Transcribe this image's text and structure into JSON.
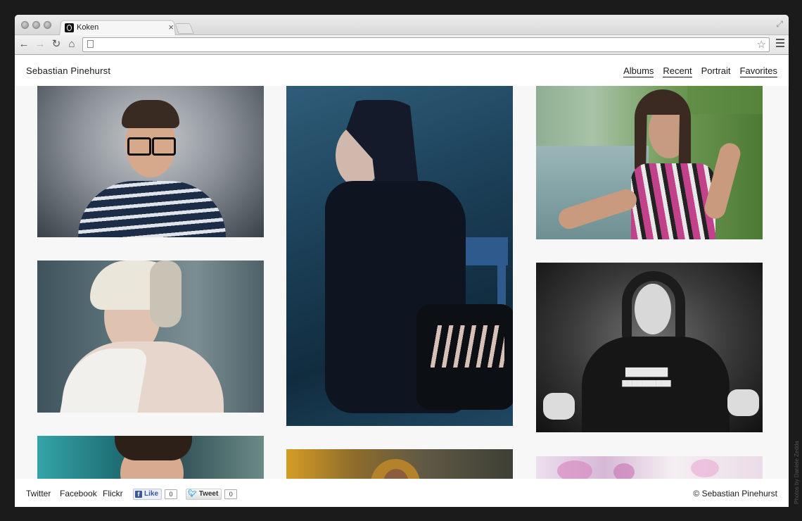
{
  "browser": {
    "tab_title": "Koken",
    "tab_close": "×",
    "url": "",
    "icons": {
      "back": "arrow-left-icon",
      "forward": "arrow-right-icon",
      "reload": "reload-icon",
      "home": "home-icon",
      "bookmark": "star-icon",
      "menu": "hamburger-menu-icon",
      "fullscreen": "fullscreen-icon"
    }
  },
  "site": {
    "title": "Sebastian Pinehurst",
    "nav": [
      {
        "label": "Albums",
        "underlined": true
      },
      {
        "label": "Recent",
        "underlined": true
      },
      {
        "label": "Portrait",
        "underlined": false
      },
      {
        "label": "Favorites",
        "underlined": true
      }
    ]
  },
  "gallery": {
    "photos": [
      {
        "subject": "man with glasses and striped sweater"
      },
      {
        "subject": "woman in dark dress on blue chair"
      },
      {
        "subject": "young woman by river"
      },
      {
        "subject": "blonde woman in knit beanie"
      },
      {
        "subject": "man in black hoodie, black and white"
      },
      {
        "subject": "man portrait, teal background"
      },
      {
        "subject": "person in yellow hood"
      },
      {
        "subject": "pink blossoms"
      }
    ]
  },
  "footer": {
    "links": [
      "Twitter",
      "Facebook",
      "Flickr"
    ],
    "like_label": "Like",
    "like_count": "0",
    "tweet_label": "Tweet",
    "tweet_count": "0",
    "copyright": "© Sebastian Pinehurst"
  },
  "credit": "Photos by Daniele Zedda",
  "colors": {
    "page_background": "#1b1b1b",
    "site_background": "#f7f7f7",
    "text": "#1a1a1a",
    "facebook_blue": "#3b5998",
    "twitter_blue": "#2fa3e6"
  }
}
